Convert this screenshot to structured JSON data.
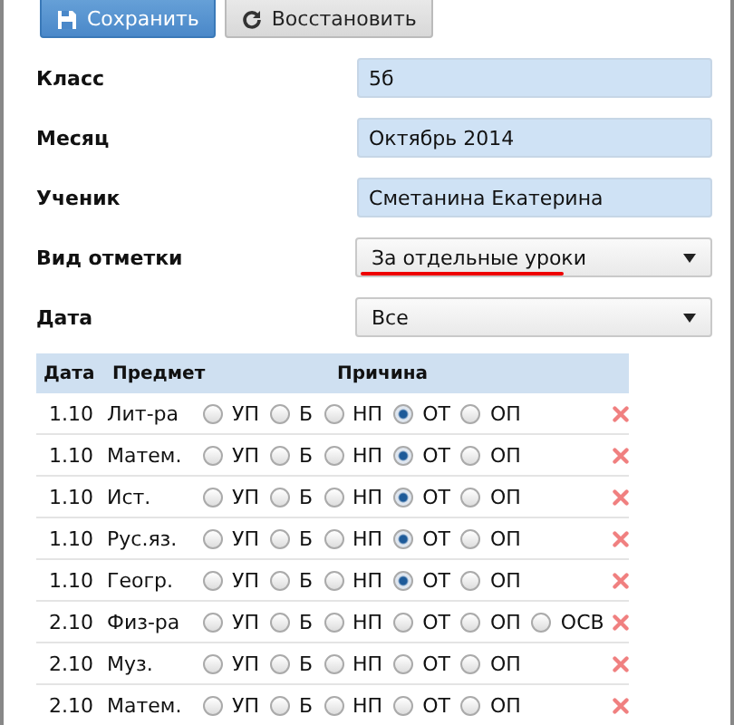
{
  "toolbar": [
    {
      "kind": "save",
      "label": "Сохранить"
    },
    {
      "kind": "restore",
      "label": "Восстановить"
    }
  ],
  "fields": [
    {
      "kind": "text",
      "label": "Класс",
      "value": "5б"
    },
    {
      "kind": "text",
      "label": "Месяц",
      "value": "Октябрь 2014"
    },
    {
      "kind": "text",
      "label": "Ученик",
      "value": "Сметанина Екатерина"
    },
    {
      "kind": "select",
      "label": "Вид отметки",
      "value": "За отдельные уроки",
      "underlined": true
    },
    {
      "kind": "select",
      "label": "Дата",
      "value": "Все",
      "underlined": false
    }
  ],
  "table": {
    "columns": [
      "Дата",
      "Предмет",
      "Причина"
    ],
    "rows": [
      {
        "date": "1.10",
        "subject": "Лит-ра",
        "options": [
          {
            "label": "УП",
            "selected": false
          },
          {
            "label": "Б",
            "selected": false
          },
          {
            "label": "НП",
            "selected": false
          },
          {
            "label": "ОТ",
            "selected": true
          },
          {
            "label": "ОП",
            "selected": false
          }
        ]
      },
      {
        "date": "1.10",
        "subject": "Матем.",
        "options": [
          {
            "label": "УП",
            "selected": false
          },
          {
            "label": "Б",
            "selected": false
          },
          {
            "label": "НП",
            "selected": false
          },
          {
            "label": "ОТ",
            "selected": true
          },
          {
            "label": "ОП",
            "selected": false
          }
        ]
      },
      {
        "date": "1.10",
        "subject": "Ист.",
        "options": [
          {
            "label": "УП",
            "selected": false
          },
          {
            "label": "Б",
            "selected": false
          },
          {
            "label": "НП",
            "selected": false
          },
          {
            "label": "ОТ",
            "selected": true
          },
          {
            "label": "ОП",
            "selected": false
          }
        ]
      },
      {
        "date": "1.10",
        "subject": "Рус.яз.",
        "options": [
          {
            "label": "УП",
            "selected": false
          },
          {
            "label": "Б",
            "selected": false
          },
          {
            "label": "НП",
            "selected": false
          },
          {
            "label": "ОТ",
            "selected": true
          },
          {
            "label": "ОП",
            "selected": false
          }
        ]
      },
      {
        "date": "1.10",
        "subject": "Геогр.",
        "options": [
          {
            "label": "УП",
            "selected": false
          },
          {
            "label": "Б",
            "selected": false
          },
          {
            "label": "НП",
            "selected": false
          },
          {
            "label": "ОТ",
            "selected": true
          },
          {
            "label": "ОП",
            "selected": false
          }
        ]
      },
      {
        "date": "2.10",
        "subject": "Физ-ра",
        "options": [
          {
            "label": "УП",
            "selected": false
          },
          {
            "label": "Б",
            "selected": false
          },
          {
            "label": "НП",
            "selected": false
          },
          {
            "label": "ОТ",
            "selected": false
          },
          {
            "label": "ОП",
            "selected": false
          },
          {
            "label": "ОСВ",
            "selected": false
          }
        ]
      },
      {
        "date": "2.10",
        "subject": "Муз.",
        "options": [
          {
            "label": "УП",
            "selected": false
          },
          {
            "label": "Б",
            "selected": false
          },
          {
            "label": "НП",
            "selected": false
          },
          {
            "label": "ОТ",
            "selected": false
          },
          {
            "label": "ОП",
            "selected": false
          }
        ]
      },
      {
        "date": "2.10",
        "subject": "Матем.",
        "options": [
          {
            "label": "УП",
            "selected": false
          },
          {
            "label": "Б",
            "selected": false
          },
          {
            "label": "НП",
            "selected": false
          },
          {
            "label": "ОТ",
            "selected": false
          },
          {
            "label": "ОП",
            "selected": false
          }
        ]
      }
    ]
  }
}
